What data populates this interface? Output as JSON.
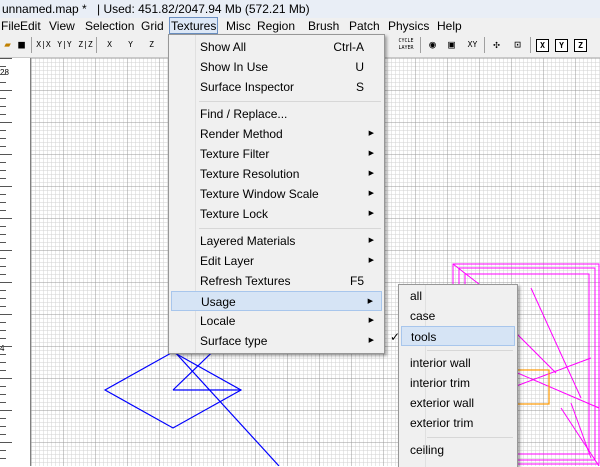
{
  "title": {
    "filename": "unnamed.map *",
    "memory": "| Used: 451.82/2047.94 Mb (572.21 Mb)"
  },
  "menubar": [
    "File",
    "Edit",
    "View",
    "Selection",
    "Grid",
    "Textures",
    "Misc",
    "Region",
    "Brush",
    "Patch",
    "Physics",
    "Help"
  ],
  "menubar_active": "Textures",
  "toolbar": {
    "icons": [
      "open-icon",
      "save-icon",
      "flip-x-icon",
      "flip-y-icon",
      "flip-z-icon",
      "rotate-x-icon",
      "rotate-y-icon",
      "rotate-z-icon",
      "cycle-layer-icon",
      "camera-icon",
      "texture-window-icon",
      "xy-view-icon",
      "patch-icon",
      "entity-icon",
      "x-axis-icon",
      "y-axis-icon",
      "z-axis-icon"
    ],
    "labels": {
      "flip_x": "X|X",
      "flip_y": "Y|Y",
      "flip_z": "Z|Z",
      "rot_x": "X",
      "rot_y": "Y",
      "rot_z": "Z",
      "layer": "CYCLE LAYER",
      "xy": "XY",
      "x": "X",
      "y": "Y",
      "z": "Z"
    }
  },
  "ruler": {
    "top": "28",
    "mid": "4"
  },
  "textures_menu": [
    {
      "label": "Show All",
      "shortcut": "Ctrl-A"
    },
    {
      "label": "Show In Use",
      "shortcut": "U"
    },
    {
      "label": "Surface Inspector",
      "shortcut": "S"
    },
    {
      "label": "Find / Replace..."
    },
    {
      "label": "Render Method",
      "submenu": true
    },
    {
      "label": "Texture Filter",
      "submenu": true
    },
    {
      "label": "Texture Resolution",
      "submenu": true
    },
    {
      "label": "Texture Window Scale",
      "submenu": true
    },
    {
      "label": "Texture Lock",
      "submenu": true
    },
    {
      "label": "Layered Materials",
      "submenu": true
    },
    {
      "label": "Edit Layer",
      "submenu": true
    },
    {
      "label": "Refresh Textures",
      "shortcut": "F5"
    },
    {
      "label": "Usage",
      "submenu": true,
      "highlighted": true
    },
    {
      "label": "Locale",
      "submenu": true
    },
    {
      "label": "Surface type",
      "submenu": true
    }
  ],
  "usage_submenu": [
    {
      "label": "all"
    },
    {
      "label": "case"
    },
    {
      "label": "tools",
      "checked": true,
      "highlighted": true
    },
    {
      "label": "interior wall"
    },
    {
      "label": "interior trim"
    },
    {
      "label": "exterior wall"
    },
    {
      "label": "exterior trim"
    },
    {
      "label": "ceiling"
    }
  ],
  "colors": {
    "grid_major": "#9a9a9a",
    "grid_minor": "#d2d2d2",
    "brush_blue": "#0000ff",
    "brush_magenta": "#ff00ff",
    "brush_orange": "#ff9900",
    "highlight": "#d6e4f5"
  }
}
